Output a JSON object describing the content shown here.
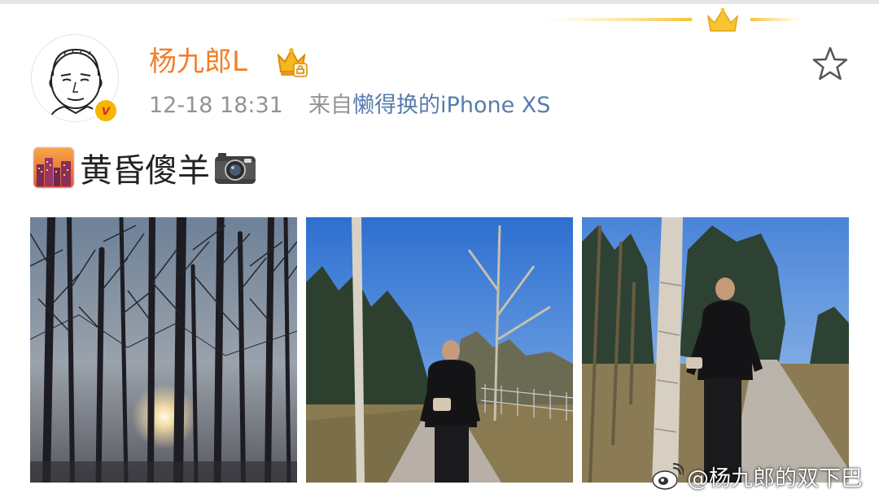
{
  "post": {
    "username": "杨九郎L",
    "timestamp": "12-18 18:31",
    "source_prefix": "来自",
    "source_device": "懒得换的iPhone XS",
    "text": "黄昏傻羊",
    "icons": {
      "verified_badge": "v-badge-icon",
      "vip": "crown-badge-icon",
      "favorite": "star-icon",
      "emoji_city": "city-sunset-emoji",
      "emoji_camera": "camera-emoji"
    },
    "images": [
      {
        "name": "trees-sunset-photo"
      },
      {
        "name": "park-path-photo-1"
      },
      {
        "name": "park-path-photo-2"
      }
    ]
  },
  "watermark": {
    "text": "@杨九郎的双下巴",
    "icon": "weibo-logo-icon"
  },
  "colors": {
    "username": "#f37f2a",
    "source_link": "#577cad",
    "meta": "#939393"
  }
}
